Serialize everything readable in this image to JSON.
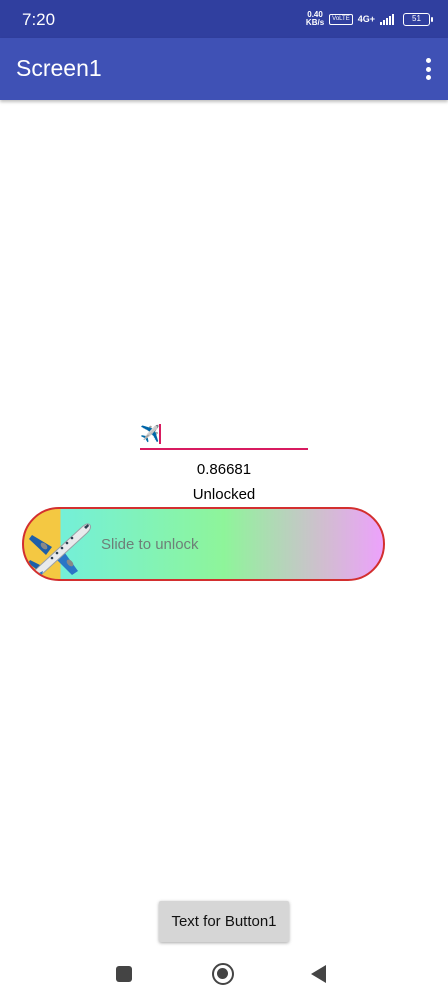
{
  "status_bar": {
    "time": "7:20",
    "net_speed_value": "0.40",
    "net_speed_unit": "KB/s",
    "volte": "VoLTE",
    "network": "4G+",
    "battery": "51"
  },
  "app_bar": {
    "title": "Screen1"
  },
  "textbox": {
    "value": "✈️"
  },
  "labels": {
    "ratio": "0.86681",
    "status": "Unlocked"
  },
  "slider": {
    "text": "Slide to unlock",
    "thumb_icon": "airplane-icon",
    "colors": {
      "border": "#d32f2f",
      "gradient_start": "#74f0d8",
      "gradient_mid": "#8ef59a",
      "gradient_end": "#eea0ff",
      "thumb_bg": "#f4c842"
    }
  },
  "button": {
    "label": "Text for Button1"
  },
  "colors": {
    "status_bar": "#303f9f",
    "app_bar": "#3f51b5",
    "accent": "#d81b60"
  }
}
